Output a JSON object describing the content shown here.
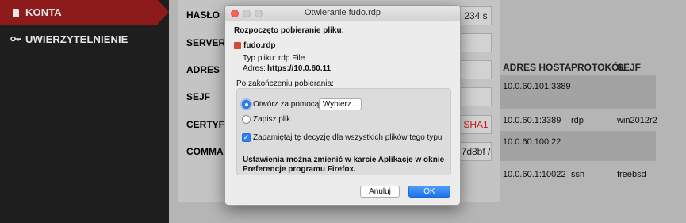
{
  "sidebar": {
    "items": [
      {
        "label": "KONTA",
        "icon": "book-icon"
      },
      {
        "label": "UWIERZYTELNIENIE",
        "icon": "key-icon"
      }
    ]
  },
  "panel": {
    "fields": [
      "HASŁO",
      "SERVER NA",
      "ADRES",
      "SEJF",
      "CERTYFIKA",
      "COMMAND"
    ],
    "values": {
      "haslo": "234 s",
      "certyfikat": "SHA1",
      "command": "7d8bf /"
    }
  },
  "table": {
    "headers": {
      "adres_hosta": "ADRES HOSTA",
      "protokol": "PROTOKÓŁ",
      "sejf": "SEJF"
    },
    "rows": [
      {
        "address": "10.0.60.101:3389",
        "protocol": "",
        "safe": ""
      },
      {
        "address": "10.0.60.1:3389",
        "protocol": "rdp",
        "safe": "win2012r2"
      },
      {
        "address": "10.0.60.100:22",
        "protocol": "",
        "safe": ""
      },
      {
        "address": "10.0.60.1:10022",
        "protocol": "ssh",
        "safe": "freebsd"
      }
    ]
  },
  "colors": {
    "accent": "#8e1b1b",
    "sidebar_bg": "#1e1e1e",
    "sha1": "#c81e1e",
    "button_blue": "#2f7ff0"
  },
  "dialog": {
    "title": "Otwieranie fudo.rdp",
    "heading": "Rozpoczęto pobieranie pliku:",
    "filename": "fudo.rdp",
    "type_label": "Typ pliku:",
    "type_value": "rdp File",
    "address_label": "Adres:",
    "address_value": "https://10.0.60.11",
    "after_download": "Po zakończeniu pobierania:",
    "open_with_label": "Otwórz za pomocą",
    "choose_button": "Wybierz...",
    "save_file_label": "Zapisz plik",
    "remember_label": "Zapamiętaj tę decyzję dla wszystkich plików tego typu",
    "note_line1": "Ustawienia można zmienić w karcie Aplikacje w oknie",
    "note_line2": "Preferencje programu Firefox.",
    "cancel_button": "Anuluj",
    "ok_button": "OK",
    "open_with_selected": true,
    "remember_checked": true
  }
}
